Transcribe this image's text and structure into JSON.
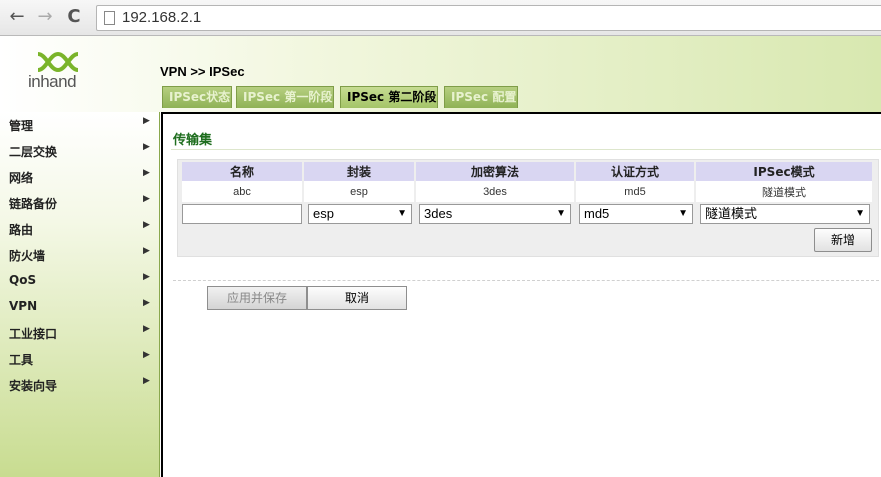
{
  "browser": {
    "back_icon": "←",
    "forward_icon": "→",
    "reload_icon": "C",
    "url": "192.168.2.1"
  },
  "logo": {
    "text": "inhand"
  },
  "breadcrumb": "VPN >> IPSec",
  "tabs": [
    {
      "label": "IPSec状态"
    },
    {
      "label": "IPSec 第一阶段"
    },
    {
      "label": "IPSec 第二阶段"
    },
    {
      "label": "IPSec 配置"
    }
  ],
  "sidebar": {
    "items": [
      {
        "label": "管理"
      },
      {
        "label": "二层交换"
      },
      {
        "label": "网络"
      },
      {
        "label": "链路备份"
      },
      {
        "label": "路由"
      },
      {
        "label": "防火墙"
      },
      {
        "label": "QoS"
      },
      {
        "label": "VPN"
      },
      {
        "label": "工业接口"
      },
      {
        "label": "工具"
      },
      {
        "label": "安装向导"
      }
    ],
    "arrow": "▶"
  },
  "section": {
    "title": "传输集"
  },
  "table": {
    "headers": [
      "名称",
      "封装",
      "加密算法",
      "认证方式",
      "IPSec模式"
    ],
    "rows": [
      [
        "abc",
        "esp",
        "3des",
        "md5",
        "隧道模式"
      ]
    ]
  },
  "form": {
    "name_value": "",
    "encap_value": "esp",
    "encrypt_value": "3des",
    "auth_value": "md5",
    "mode_value": "隧道模式",
    "dropdown_arrow": "▼",
    "add_label": "新增"
  },
  "buttons": {
    "apply_label": "应用并保存",
    "cancel_label": "取消"
  },
  "colors": {
    "accent_green": "#8fb256",
    "title_green": "#1f6e1f",
    "header_lavender": "#d9d6f2"
  }
}
